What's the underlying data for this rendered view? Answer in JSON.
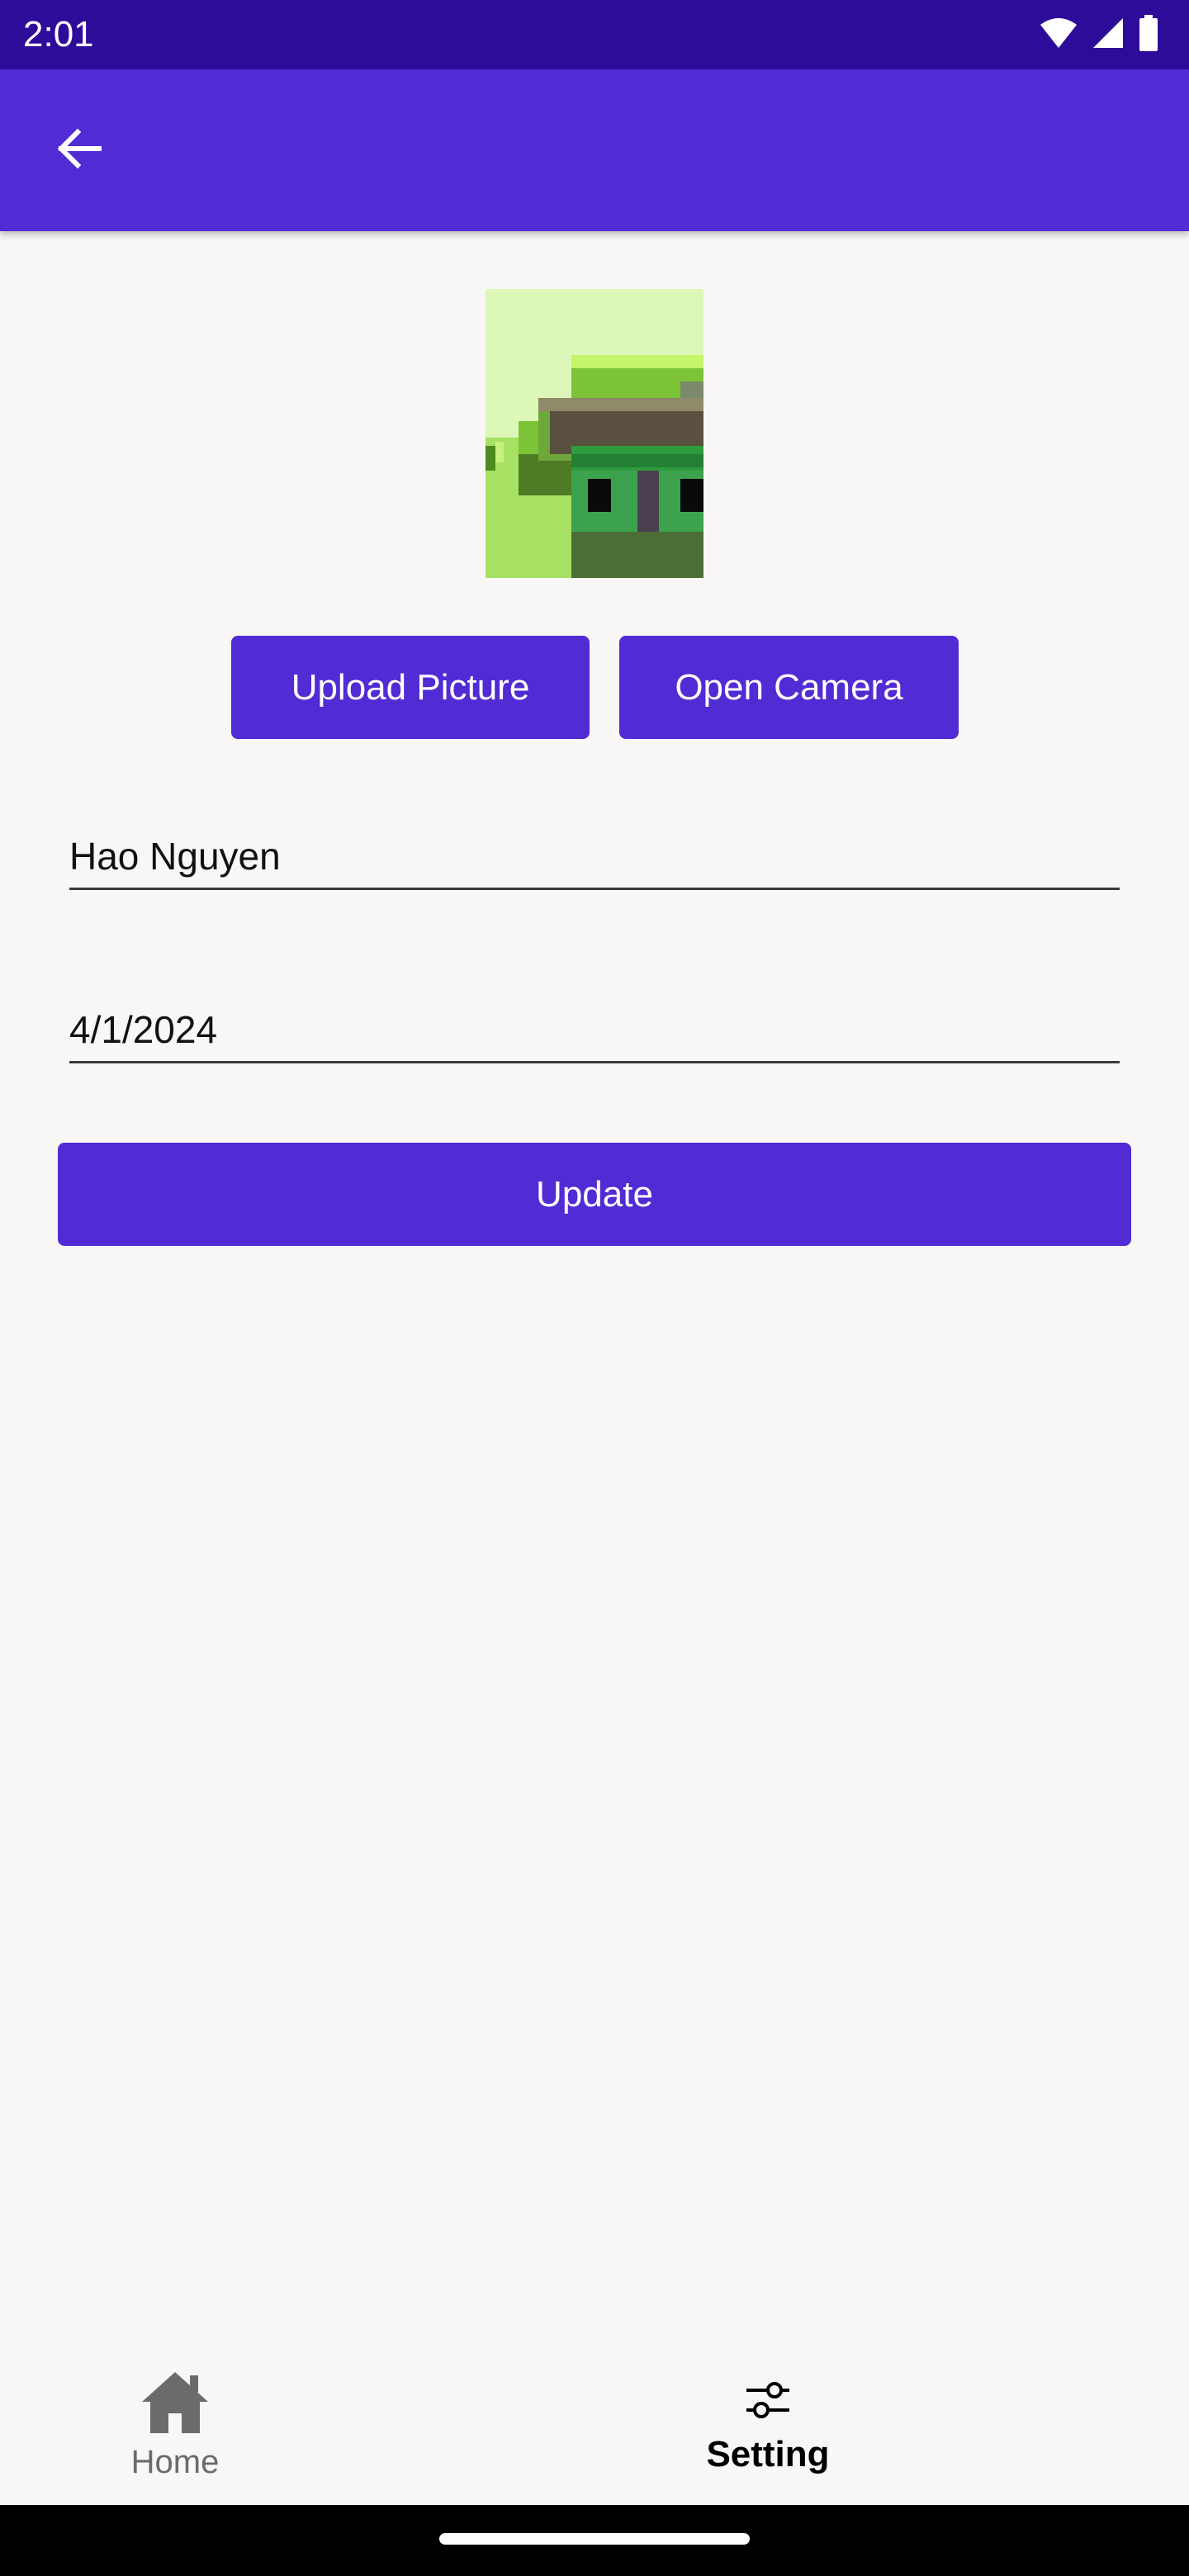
{
  "status_bar": {
    "time": "2:01",
    "icons": [
      "wifi-icon",
      "signal-icon",
      "battery-icon"
    ]
  },
  "app_bar": {
    "back_icon": "arrow-back-icon",
    "color": "#512bd4"
  },
  "profile": {
    "upload_label": "Upload Picture",
    "camera_label": "Open Camera",
    "name_value": "Hao Nguyen",
    "date_value": "4/1/2024",
    "update_label": "Update"
  },
  "bottom_nav": {
    "items": [
      {
        "label": "Home",
        "icon": "home-icon",
        "selected": false
      },
      {
        "label": "Setting",
        "icon": "sliders-icon",
        "selected": true
      }
    ]
  },
  "colors": {
    "accent": "#512bd4",
    "status_bar": "#2d0c9a",
    "background": "#f9f7f5"
  }
}
